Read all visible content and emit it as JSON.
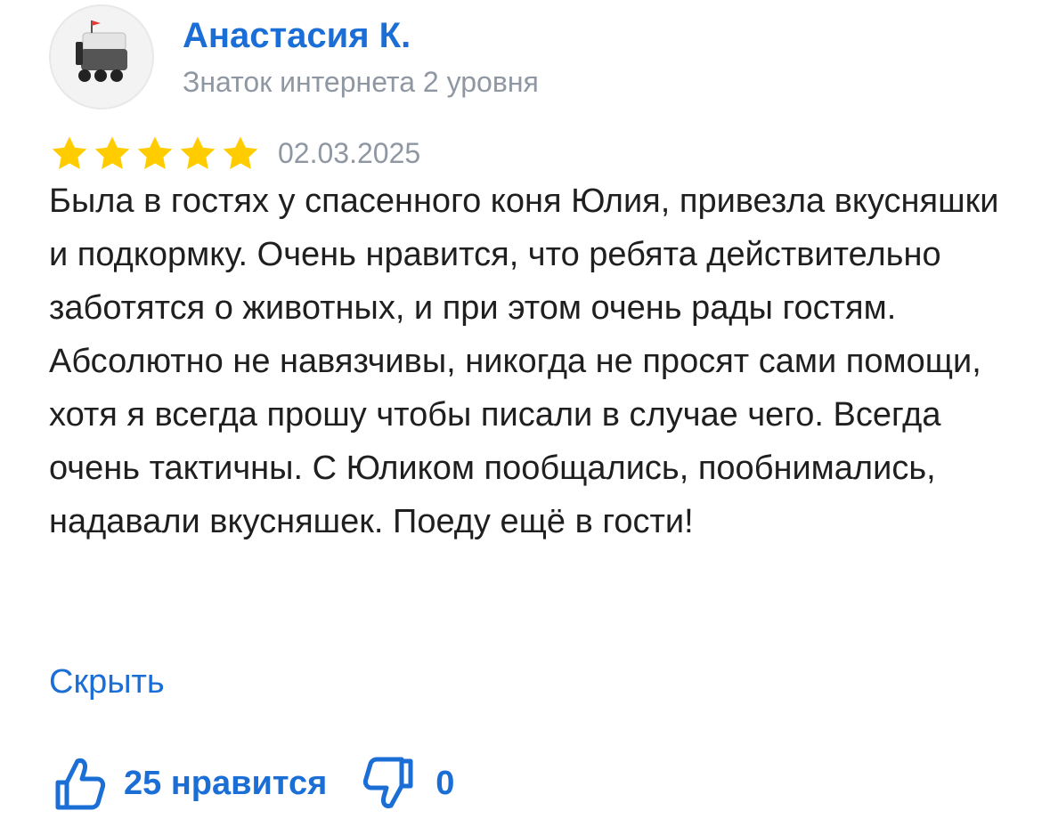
{
  "review": {
    "author_name": "Анастасия К.",
    "author_level": "Знаток интернета 2 уровня",
    "rating": 5,
    "rating_max": 5,
    "date": "02.03.2025",
    "text": "Была в гостях у спасенного коня Юлия, привезла вкусняшки и подкормку. Очень нравится, что ребята действительно заботятся о животных, и при этом очень рады гостям. Абсолютно не навязчивы, никогда не просят сами помощи, хотя я всегда прошу чтобы писали в случае чего. Всегда очень тактичны. С Юликом пообщались, пообнимались, надавали вкусняшек. Поеду ещё в гости!",
    "hide_label": "Скрыть",
    "likes_label": "25 нравится",
    "dislikes_count": "0"
  },
  "icons": {
    "avatar": "delivery-robot-icon",
    "star": "star-icon",
    "like": "thumbs-up-icon",
    "dislike": "thumbs-down-icon"
  },
  "colors": {
    "accent": "#1a6ed6",
    "star": "#ffcc00",
    "muted": "#8f97a3",
    "text": "#1f1f1f"
  }
}
